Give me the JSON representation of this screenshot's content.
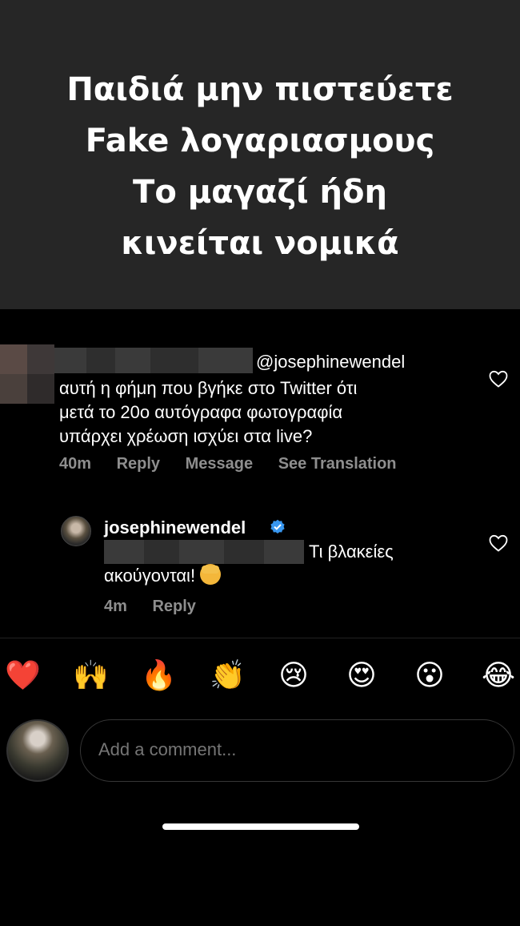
{
  "banner": {
    "lines": [
      "Παιδιά μην πιστεύετε",
      "Fake λογαριασμους",
      "Το μαγαζί ήδη",
      "κινείται νομικά"
    ]
  },
  "comment": {
    "mention": "@josephinewendel",
    "body_lines": [
      "αυτή η φήμη που βγήκε στο Twitter ότι",
      "μετά το 20ο αυτόγραφα φωτογραφία",
      "υπάρχει χρέωση ισχύει στα live?"
    ],
    "time": "40m",
    "reply_label": "Reply",
    "message_label": "Message",
    "translate_label": "See Translation"
  },
  "reply": {
    "username": "josephinewendel",
    "text_line1": "Τι βλακείες",
    "text_line2": "ακούγονται!",
    "time": "4m",
    "reply_label": "Reply"
  },
  "reactions": [
    {
      "icon": "red-heart-icon",
      "glyph": "❤️"
    },
    {
      "icon": "raising-hands-icon",
      "glyph": "🙌"
    },
    {
      "icon": "fire-icon",
      "glyph": "🔥"
    },
    {
      "icon": "clapping-hands-icon",
      "glyph": "👏"
    },
    {
      "icon": "crying-face-icon",
      "glyph": "😢"
    },
    {
      "icon": "heart-eyes-icon",
      "glyph": "😍"
    },
    {
      "icon": "surprised-face-icon",
      "glyph": "😮"
    },
    {
      "icon": "tears-of-joy-icon",
      "glyph": "😂"
    }
  ],
  "composer": {
    "placeholder": "Add a comment..."
  },
  "colors": {
    "banner_bg": "#262626",
    "muted_text": "#8e8e8e",
    "verified_blue": "#3897f0"
  }
}
